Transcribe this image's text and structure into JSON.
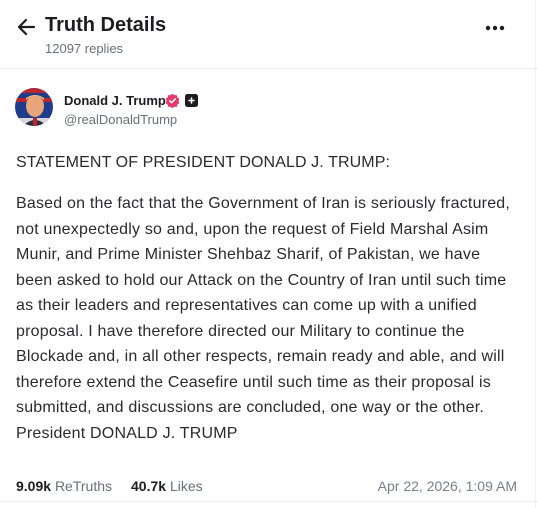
{
  "header": {
    "title": "Truth Details",
    "replies": "12097 replies",
    "icons": {
      "back": "arrow-left-icon",
      "more": "more-horizontal-icon"
    }
  },
  "author": {
    "display_name": "Donald J. Trump",
    "handle": "@realDonaldTrump",
    "verified": true,
    "badge_color": "#e63a6a"
  },
  "post": {
    "heading": "STATEMENT OF PRESIDENT DONALD J. TRUMP:",
    "body": "Based on the fact that the Government of Iran is seriously fractured, not unexpectedly so and, upon the request of Field Marshal Asim Munir, and Prime Minister Shehbaz Sharif, of Pakistan, we have been asked to hold our Attack on the Country of Iran until such time as their leaders and representatives can come up with a unified proposal. I have therefore directed our Military to continue the Blockade and, in all other respects, remain ready and able, and will therefore extend the Ceasefire until such time as their proposal is submitted, and discussions are concluded, one way or the other. President DONALD J. TRUMP"
  },
  "stats": {
    "retruths_count": "9.09k",
    "retruths_label": "ReTruths",
    "likes_count": "40.7k",
    "likes_label": "Likes",
    "timestamp": "Apr 22, 2026, 1:09 AM"
  }
}
